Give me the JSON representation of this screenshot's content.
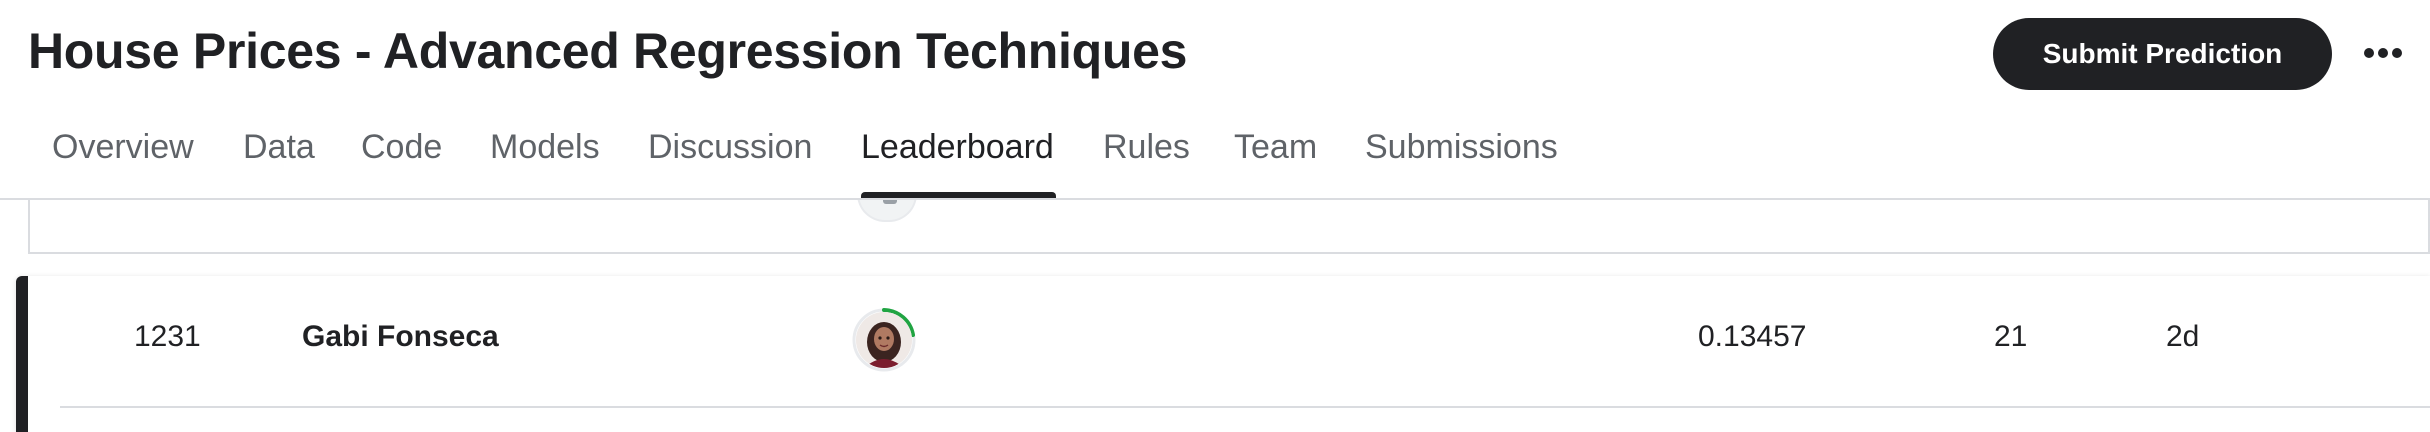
{
  "header": {
    "title": "House Prices - Advanced Regression Techniques",
    "submit_label": "Submit Prediction",
    "more_icon": "more-horizontal-icon"
  },
  "tabs": [
    {
      "label": "Overview"
    },
    {
      "label": "Data"
    },
    {
      "label": "Code"
    },
    {
      "label": "Models"
    },
    {
      "label": "Discussion"
    },
    {
      "label": "Leaderboard",
      "active": true
    },
    {
      "label": "Rules"
    },
    {
      "label": "Team"
    },
    {
      "label": "Submissions"
    }
  ],
  "leaderboard": {
    "row": {
      "rank": "1231",
      "team": "Gabi Fonseca",
      "score": "0.13457",
      "entries": "21",
      "last": "2d"
    }
  },
  "colors": {
    "primary": "#202124",
    "tab_inactive": "#5f6368",
    "divider": "#dadce0",
    "progress_ring": "#20a442"
  }
}
